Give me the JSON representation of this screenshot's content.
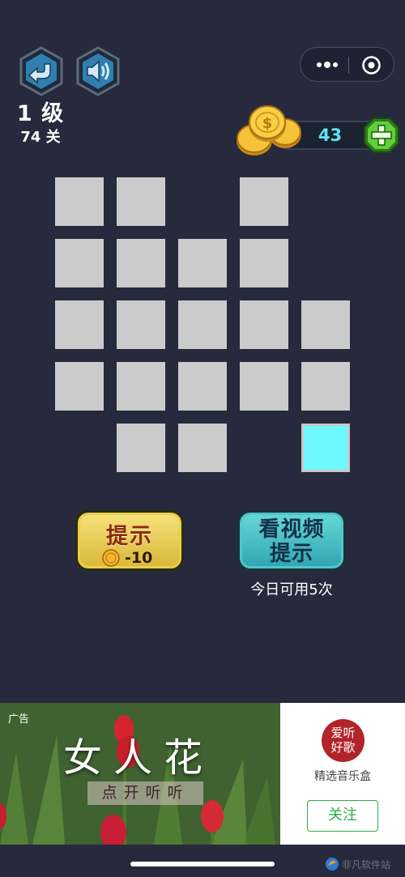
{
  "header": {
    "level": "1 级",
    "stage": "74 关",
    "coins": "43"
  },
  "grid": {
    "active_cell": {
      "row": 5,
      "col": 5
    },
    "cells": [
      [
        1,
        1,
        0,
        1,
        0
      ],
      [
        1,
        1,
        1,
        1,
        0
      ],
      [
        1,
        1,
        1,
        1,
        1
      ],
      [
        1,
        1,
        1,
        1,
        1
      ],
      [
        0,
        1,
        1,
        0,
        1
      ]
    ]
  },
  "buttons": {
    "hint_label": "提示",
    "hint_cost": "-10",
    "video_line1": "看视频",
    "video_line2": "提示",
    "video_sub": "今日可用5次"
  },
  "ad": {
    "tag": "广告",
    "title": "女人花",
    "subtitle": "点开听听",
    "logo_line1": "爱听",
    "logo_line2": "好歌",
    "app_name": "精选音乐盒",
    "follow_label": "关注"
  },
  "watermark": "非凡软件站",
  "colors": {
    "background": "#262a3c",
    "tile": "#cbcbcb",
    "tile_active": "#6ef8ff",
    "coin_text": "#5fe3f2",
    "follow_green": "#2aae4a"
  },
  "icons": [
    "back-arrow-icon",
    "speaker-icon",
    "more-dots-icon",
    "target-icon",
    "gold-coins-icon",
    "plus-gem-icon",
    "coin-icon"
  ]
}
